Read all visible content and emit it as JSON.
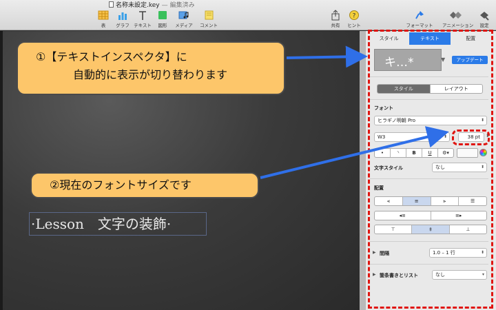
{
  "window": {
    "title": "名称未設定.key",
    "separator": "—",
    "edited": "編集済み"
  },
  "toolbar": {
    "left_items": [
      {
        "label": "表",
        "icon": "table-icon"
      },
      {
        "label": "グラフ",
        "icon": "chart-icon"
      },
      {
        "label": "テキスト",
        "icon": "text-icon"
      },
      {
        "label": "図形",
        "icon": "shape-icon"
      },
      {
        "label": "メディア",
        "icon": "media-icon"
      },
      {
        "label": "コメント",
        "icon": "comment-icon"
      }
    ],
    "right_items": [
      {
        "label": "共有",
        "icon": "share-icon"
      },
      {
        "label": "ヒント",
        "icon": "help-icon"
      },
      {
        "label": "フォーマット",
        "icon": "format-brush-icon"
      },
      {
        "label": "アニメーション",
        "icon": "animate-icon"
      },
      {
        "label": "設定",
        "icon": "setup-icon"
      }
    ]
  },
  "slide": {
    "text": "·Lesson　文字の装飾·"
  },
  "callouts": {
    "first_line1": "①【テキストインスペクタ】に",
    "first_line2": "自動的に表示が切り替わります",
    "second": "②現在のフォントサイズです"
  },
  "inspector": {
    "tabs": [
      "スタイル",
      "テキスト",
      "配置"
    ],
    "active_tab": "テキスト",
    "style_preview": "キ…*",
    "update_button": "アップデート",
    "segment": [
      "スタイル",
      "レイアウト"
    ],
    "font_label": "フォント",
    "font_family": "ヒラギノ明朝 Pro",
    "font_weight": "W3",
    "font_size": "38 pt",
    "format_buttons": [
      "B",
      "U"
    ],
    "char_style_label": "文字スタイル",
    "char_style_value": "なし",
    "align_label": "配置",
    "spacing_label": "間隔",
    "spacing_value": "1.0 – 1 行",
    "bullets_label": "箇条書きとリスト",
    "bullets_value": "なし",
    "colors": {
      "accent": "#2b7be8",
      "callout": "#fdc66a",
      "highlight": "#e0140f",
      "arrow": "#2f6fe8"
    }
  }
}
